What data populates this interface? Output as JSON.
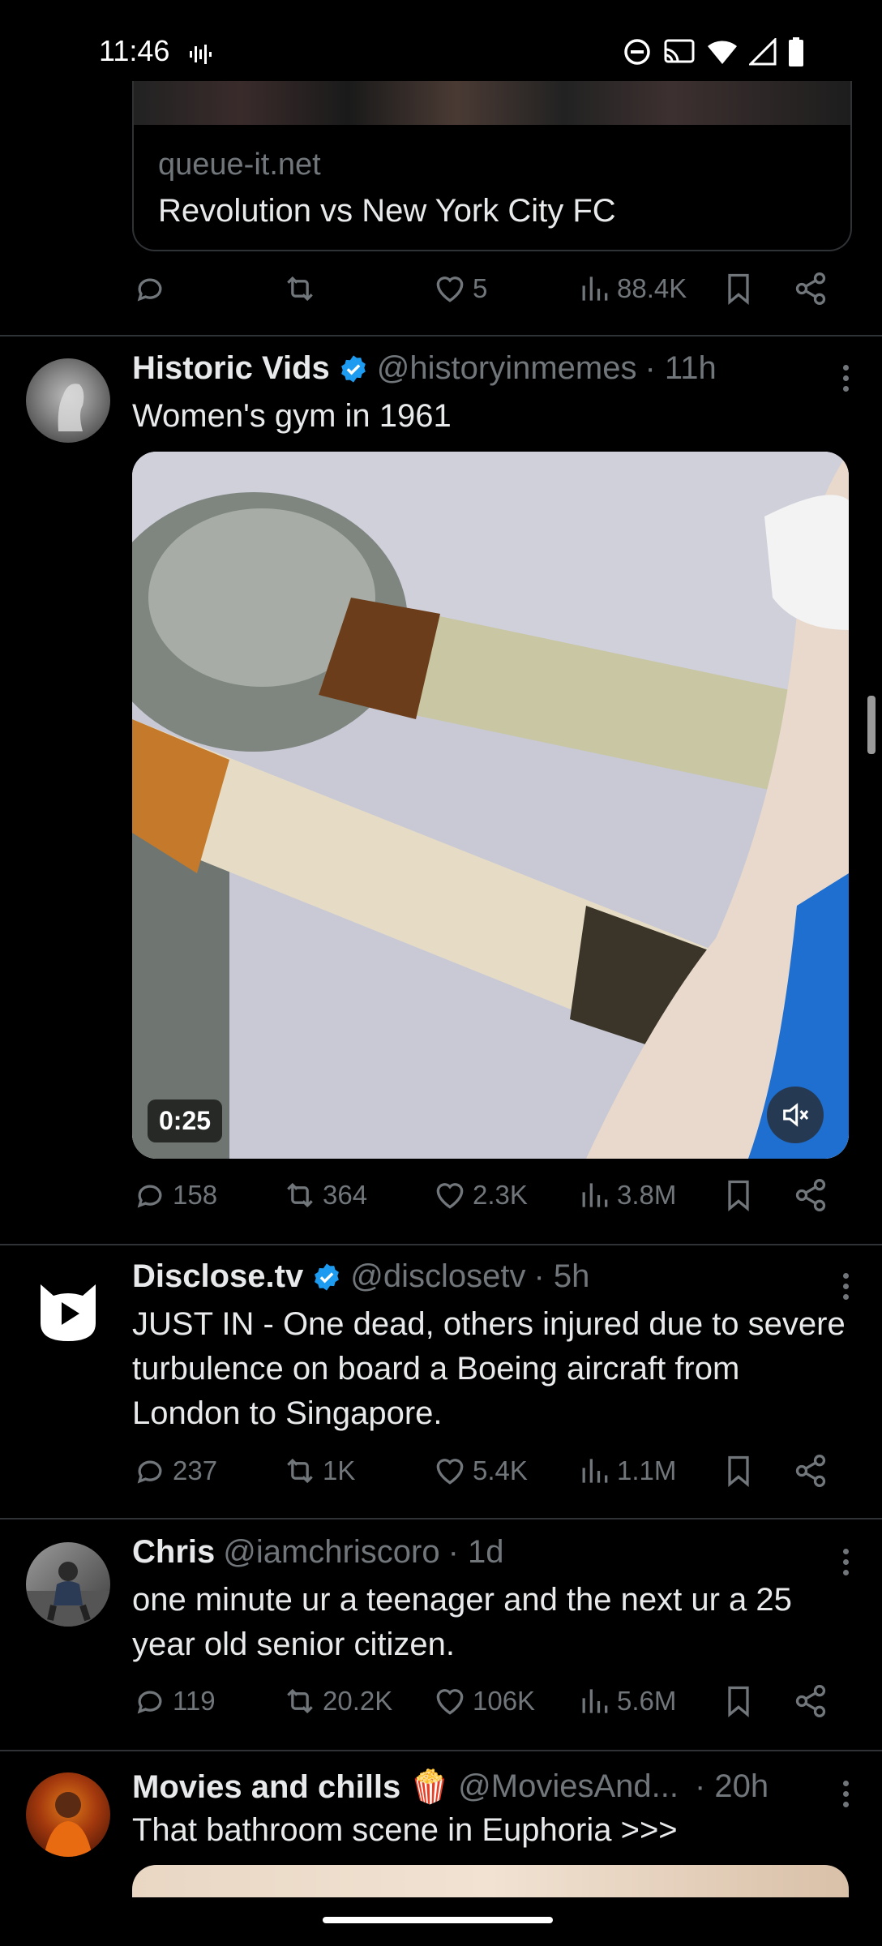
{
  "status_bar": {
    "time": "11:46"
  },
  "link_preview": {
    "domain": "queue-it.net",
    "title": "Revolution vs New York City FC",
    "stats": {
      "replies": "",
      "retweets": "",
      "likes": "5",
      "views": "88.4K"
    }
  },
  "tweets": [
    {
      "name": "Historic Vids",
      "verified": true,
      "handle": "@historyinmemes",
      "time": "· 11h",
      "text": "Women's gym in 1961",
      "video_duration": "0:25",
      "stats": {
        "replies": "158",
        "retweets": "364",
        "likes": "2.3K",
        "views": "3.8M"
      }
    },
    {
      "name": "Disclose.tv",
      "verified": true,
      "handle": "@disclosetv",
      "time": "· 5h",
      "text": "JUST IN - One dead, others injured due to severe turbulence on board a Boeing aircraft from London to Singapore.",
      "stats": {
        "replies": "237",
        "retweets": "1K",
        "likes": "5.4K",
        "views": "1.1M"
      }
    },
    {
      "name": "Chris",
      "verified": false,
      "handle": "@iamchriscoro",
      "time": "· 1d",
      "text": "one minute ur a teenager and the next ur a 25 year old senior citizen.",
      "stats": {
        "replies": "119",
        "retweets": "20.2K",
        "likes": "106K",
        "views": "5.6M"
      }
    },
    {
      "name": "Movies and chills 🍿",
      "verified": false,
      "handle": "@MoviesAnd...",
      "time": "· 20h",
      "text": "That bathroom scene in Euphoria >>>"
    }
  ],
  "colors": {
    "background": "#000000",
    "text": "#e7e9ea",
    "muted": "#71767b",
    "verified": "#1d9bf0",
    "divider": "#2f3336"
  }
}
